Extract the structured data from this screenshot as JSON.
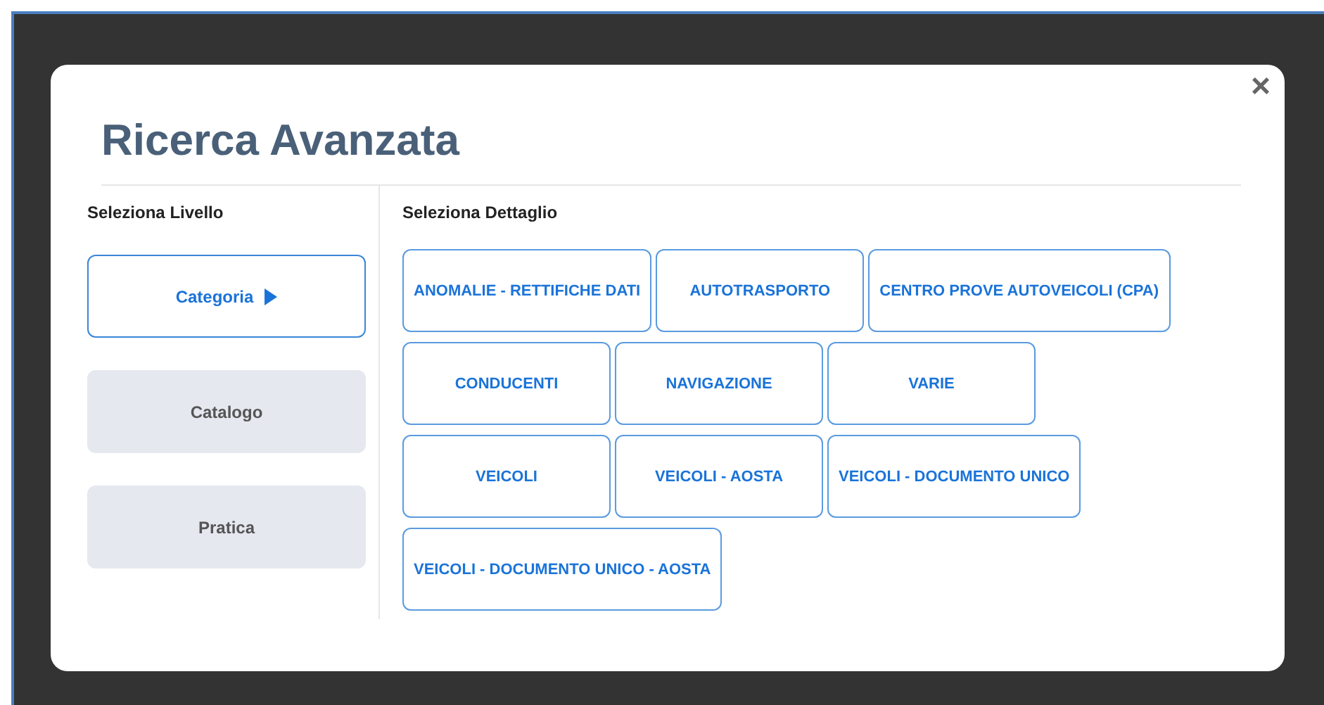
{
  "dialog": {
    "title": "Ricerca Avanzata",
    "close": "×"
  },
  "levels": {
    "heading": "Seleziona Livello",
    "items": [
      {
        "label": "Categoria",
        "selected": true
      },
      {
        "label": "Catalogo",
        "selected": false
      },
      {
        "label": "Pratica",
        "selected": false
      }
    ]
  },
  "details": {
    "heading": "Seleziona Dettaglio",
    "rows": [
      [
        "ANOMALIE - RETTIFICHE DATI",
        "AUTOTRASPORTO",
        "CENTRO PROVE AUTOVEICOLI (CPA)"
      ],
      [
        "CONDUCENTI",
        "NAVIGAZIONE",
        "VARIE"
      ],
      [
        "VEICOLI",
        "VEICOLI - AOSTA",
        "VEICOLI - DOCUMENTO UNICO"
      ],
      [
        "VEICOLI - DOCUMENTO UNICO - AOSTA"
      ]
    ]
  }
}
